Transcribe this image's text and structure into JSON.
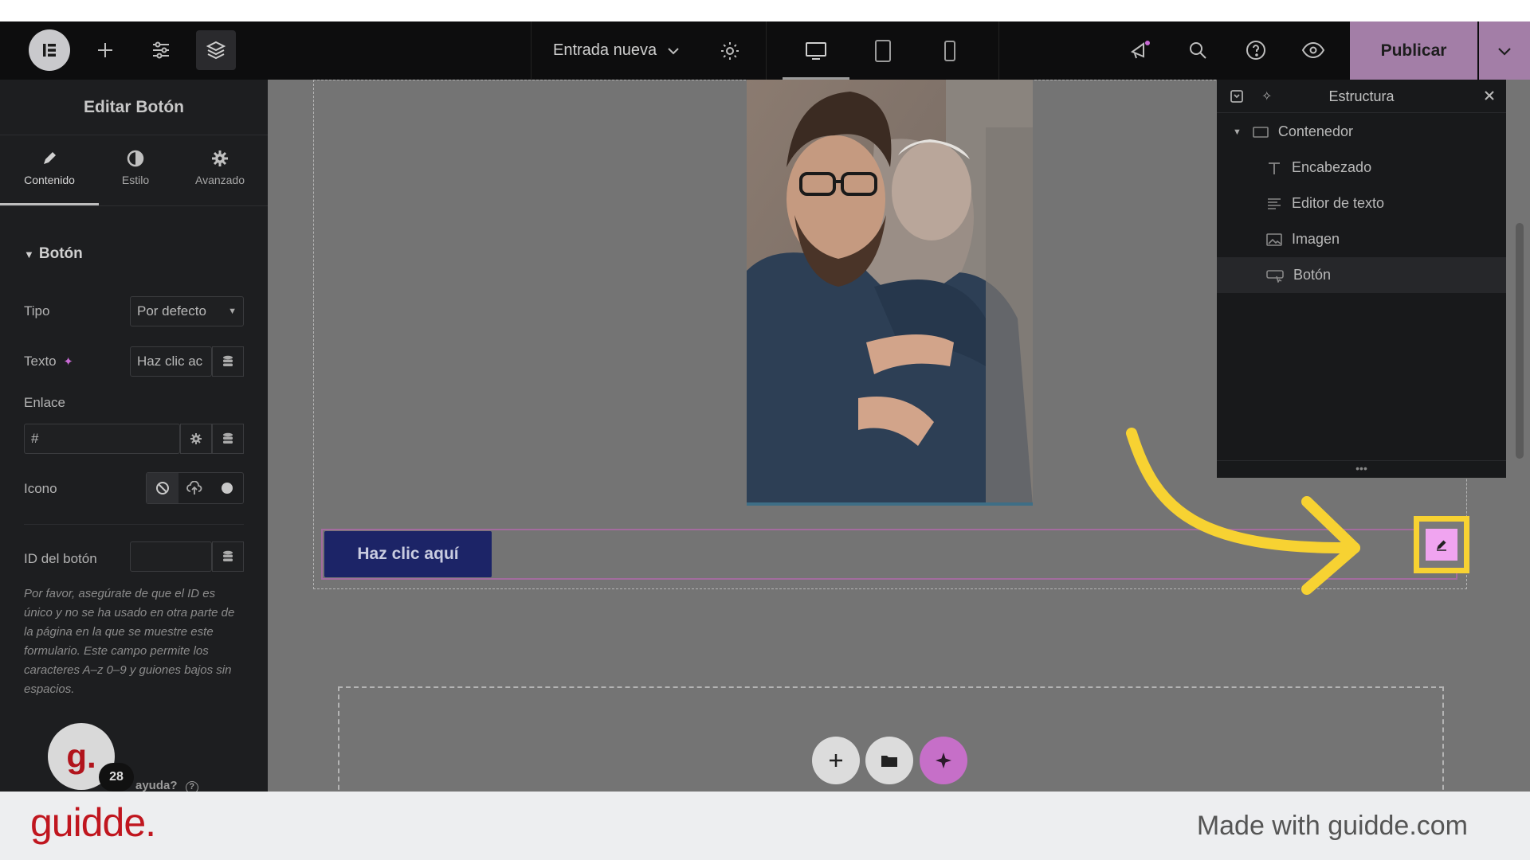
{
  "topbar": {
    "doc_title": "Entrada nueva",
    "publish_label": "Publicar"
  },
  "left_panel": {
    "title": "Editar Botón",
    "tabs": [
      {
        "label": "Contenido",
        "icon": "pencil-icon",
        "active": true
      },
      {
        "label": "Estilo",
        "icon": "contrast-icon",
        "active": false
      },
      {
        "label": "Avanzado",
        "icon": "gear-icon",
        "active": false
      }
    ],
    "section_title": "Botón",
    "tipo_label": "Tipo",
    "tipo_value": "Por defecto",
    "texto_label": "Texto",
    "texto_value": "Haz clic ac",
    "enlace_label": "Enlace",
    "enlace_value": "#",
    "icono_label": "Icono",
    "id_label": "ID del botón",
    "id_value": "",
    "help_text": "Por favor, asegúrate de que el ID es único y no se ha usado en otra parte de la página en la que se muestre este formulario. Este campo permite los caracteres A–z  0–9 y guiones bajos sin espacios.",
    "help_link": "ayuda?",
    "badge_count": "28"
  },
  "canvas": {
    "button_text": "Haz clic aquí"
  },
  "structure": {
    "title": "Estructura",
    "items": [
      {
        "label": "Contenedor",
        "icon": "container-icon"
      },
      {
        "label": "Encabezado",
        "icon": "heading-icon"
      },
      {
        "label": "Editor de texto",
        "icon": "text-editor-icon"
      },
      {
        "label": "Imagen",
        "icon": "image-icon"
      },
      {
        "label": "Botón",
        "icon": "button-icon"
      }
    ]
  },
  "footer": {
    "logo": "guidde.",
    "made_with": "Made with guidde.com"
  },
  "colors": {
    "publish": "#a37ea7",
    "highlight": "#f7d232",
    "button": "#1c2467",
    "brand": "#c0161f"
  }
}
